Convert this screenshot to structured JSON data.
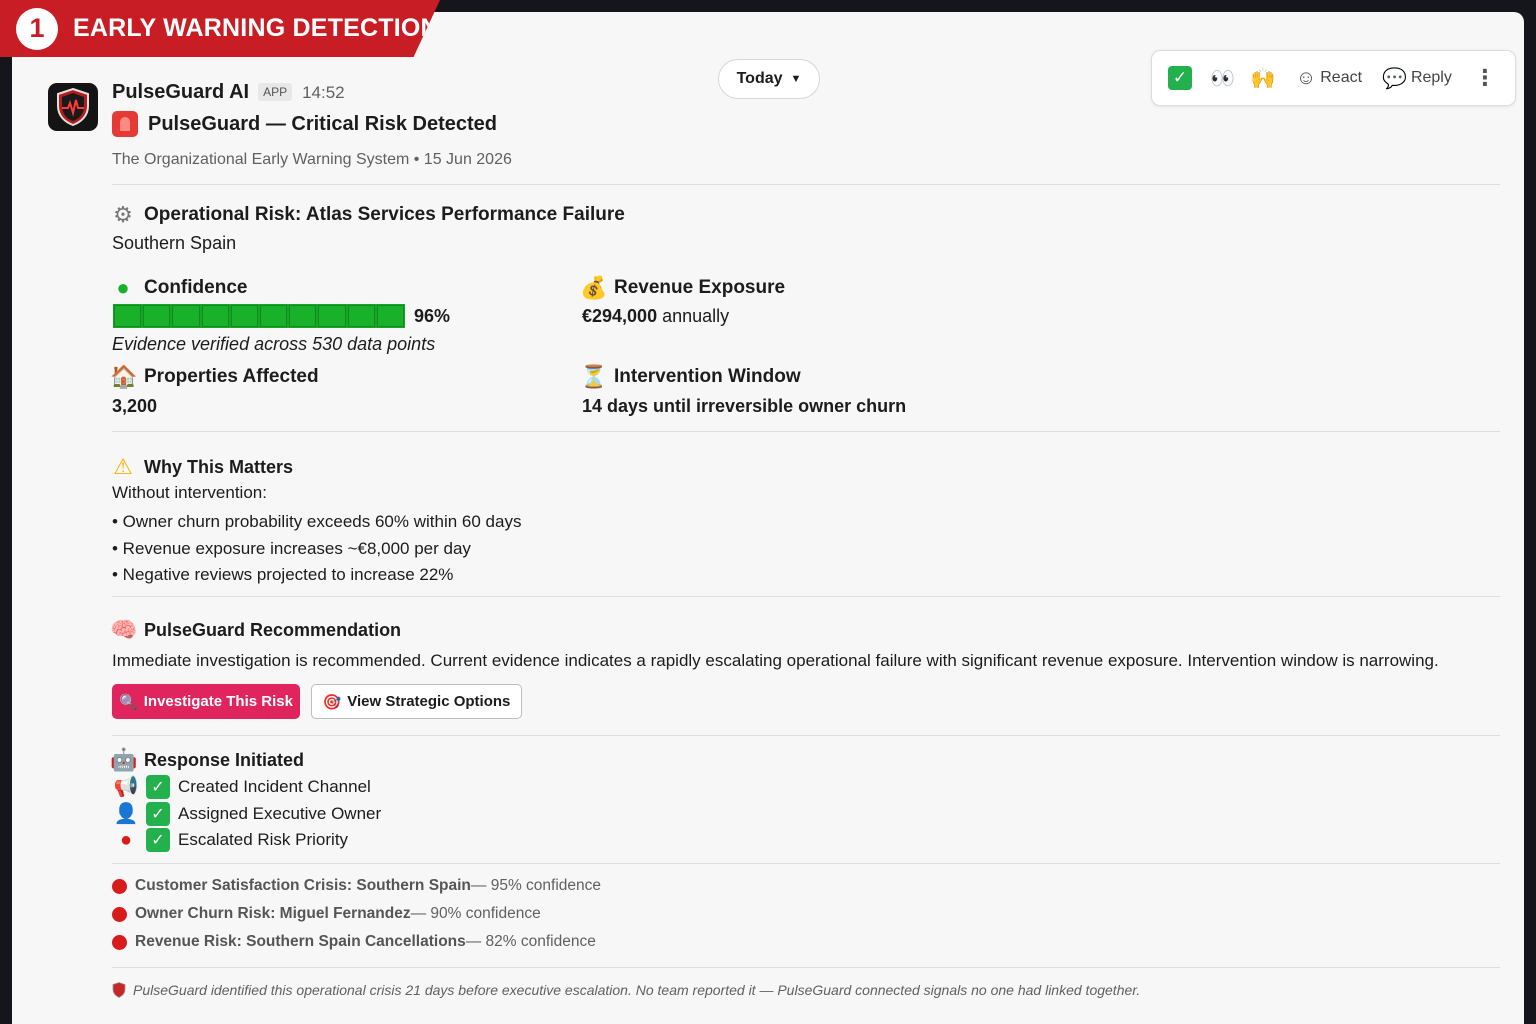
{
  "banner": {
    "number": "1",
    "label": "EARLY WARNING DETECTION"
  },
  "message": {
    "bot_name": "PulseGuard AI",
    "badge": "APP",
    "time": "14:52",
    "title": "PulseGuard — Critical Risk Detected",
    "subtitle": "The Organizational Early Warning System • 15 Jun 2026"
  },
  "date_pill": {
    "label": "Today"
  },
  "toolbar": {
    "react_label": "React",
    "reply_label": "Reply"
  },
  "risk": {
    "title": "Operational Risk: Atlas Services Performance Failure",
    "region": "Southern Spain",
    "confidence": {
      "label": "Confidence",
      "value": 96,
      "value_text": "96%",
      "evidence": "Evidence verified across 530 data points"
    },
    "revenue": {
      "label": "Revenue Exposure",
      "value": "€294,000",
      "suffix": " annually"
    },
    "properties": {
      "label": "Properties Affected",
      "value": "3,200"
    },
    "window": {
      "label": "Intervention Window",
      "value": "14 days until irreversible owner churn"
    }
  },
  "why": {
    "title": "Why This Matters",
    "intro": "Without intervention:",
    "bullets": [
      "• Owner churn probability exceeds 60% within 60 days",
      "• Revenue exposure increases ~€8,000 per day",
      "• Negative reviews projected to increase 22%"
    ]
  },
  "recommendation": {
    "title": "PulseGuard Recommendation",
    "text": "Immediate investigation is recommended. Current evidence indicates a rapidly escalating operational failure with significant revenue exposure. Intervention window is narrowing.",
    "primary_button": "Investigate This Risk",
    "secondary_button": "View Strategic Options"
  },
  "response": {
    "title": "Response Initiated",
    "items": [
      "Created Incident Channel",
      "Assigned Executive Owner",
      "Escalated Risk Priority"
    ]
  },
  "related": [
    {
      "name": "Customer Satisfaction Crisis: Southern Spain",
      "confidence": " — 95% confidence"
    },
    {
      "name": "Owner Churn Risk: Miguel Fernandez",
      "confidence": " — 90% confidence"
    },
    {
      "name": "Revenue Risk: Southern Spain Cancellations",
      "confidence": " — 82% confidence"
    }
  ],
  "footer": "PulseGuard identified this operational crisis 21 days before executive escalation. No team reported it — PulseGuard connected signals no one had linked together.",
  "colors": {
    "banner": "#c81d25",
    "primary_button": "#e0245e",
    "progress": "#19b02a",
    "check": "#22b14c",
    "risk_dot": "#d81b1b"
  }
}
